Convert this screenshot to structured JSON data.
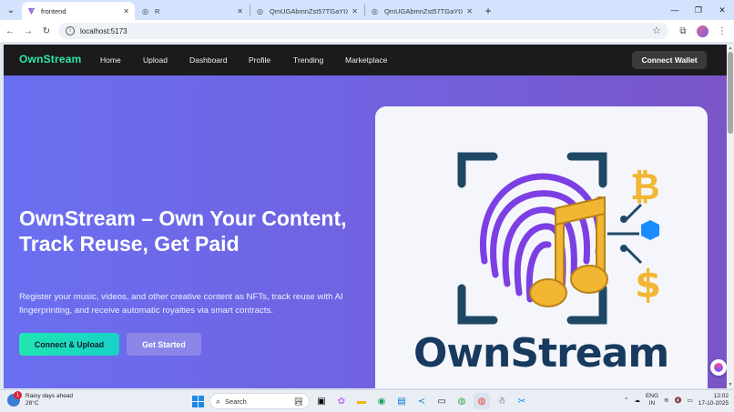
{
  "browser": {
    "tabs": [
      {
        "title": "frontend",
        "active": true
      },
      {
        "title": "R",
        "active": false
      },
      {
        "title": "QmUGAbmnZst57TGaYtXzXdi...",
        "active": false
      },
      {
        "title": "QmUGAbmnZst57TGaYtXzXdi...",
        "active": false
      }
    ],
    "address": "localhost:5173"
  },
  "site": {
    "logo": "OwnStream",
    "nav": [
      "Home",
      "Upload",
      "Dashboard",
      "Profile",
      "Trending",
      "Marketplace"
    ],
    "connect_wallet": "Connect Wallet"
  },
  "hero": {
    "title": "OwnStream – Own Your Content, Track Reuse, Get Paid",
    "subtitle": "Register your music, videos, and other creative content as NFTs, track reuse with AI fingerprinting, and receive automatic royalties via smart contracts.",
    "primary_button": "Connect & Upload",
    "secondary_button": "Get Started",
    "image_wordmark": "OwnStream"
  },
  "taskbar": {
    "weather_line1": "Rainy days ahead",
    "weather_line2": "28°C",
    "weather_badge": "1",
    "search_placeholder": "Search",
    "lang_line1": "ENG",
    "lang_line2": "IN",
    "time": "12:02",
    "date": "17-10-2025"
  },
  "colors": {
    "accent": "#2ee6a8",
    "nav_bg": "#1b1b1d",
    "hero_start": "#6a6ff0",
    "hero_end": "#7a55c8"
  }
}
